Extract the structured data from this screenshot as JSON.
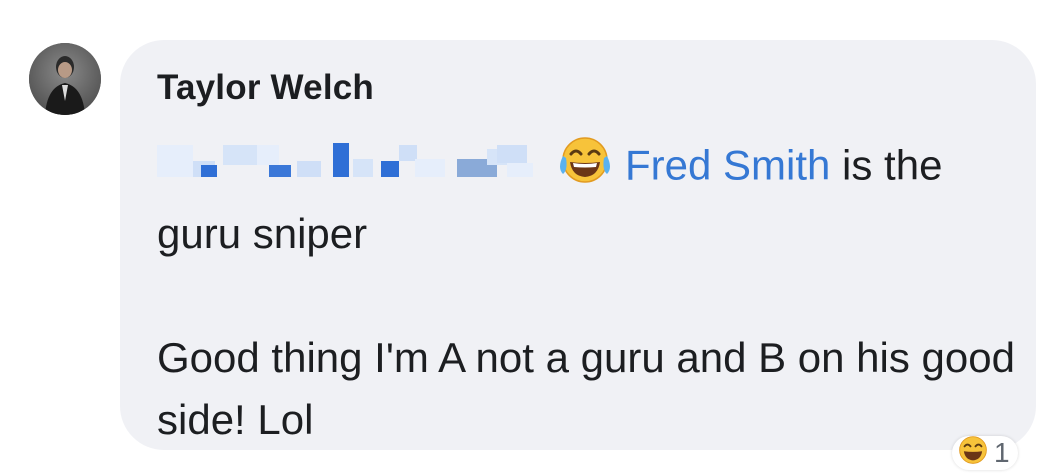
{
  "comment": {
    "author": "Taylor Welch",
    "mention": "Fred Smith",
    "line1_after_mention": " is the",
    "line2": "guru sniper",
    "paragraph2": "Good thing I'm A not a guru and B on his good side! Lol",
    "inline_emoji": "face-with-tears-of-joy-icon"
  },
  "reaction": {
    "emoji": "face-with-tears-of-joy-icon",
    "count": "1"
  },
  "colors": {
    "bubble": "#f0f1f5",
    "mention": "#3578d4",
    "text": "#1c1e21"
  }
}
